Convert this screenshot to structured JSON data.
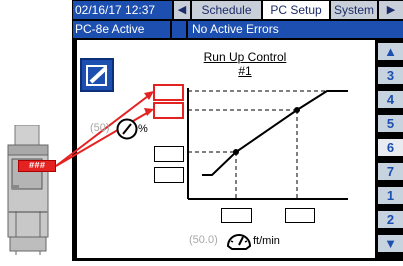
{
  "header": {
    "datetime": "02/16/17 12:37",
    "back_arrow": "◀",
    "tabs": [
      {
        "label": "Schedule",
        "active": false
      },
      {
        "label": "PC Setup",
        "active": true
      },
      {
        "label": "System",
        "active": false
      }
    ],
    "forward_arrow": "▶",
    "status_left": "PC-8e Active",
    "status_right": "No Active Errors"
  },
  "screen": {
    "title": "Run Up Control",
    "subtitle": "#1",
    "edit_icon": "edit-pencil-icon",
    "pressure_value": "(50)",
    "pressure_unit": "%",
    "speed_value": "(50.0)",
    "speed_unit": "ft/min"
  },
  "side_buttons": {
    "up": "▲",
    "items": [
      "3",
      "4",
      "5",
      "6",
      "7",
      "1",
      "2"
    ],
    "down": "▼",
    "selected": "6"
  },
  "device": {
    "display": "###"
  },
  "colors": {
    "header_blue": "#1d4fb0",
    "highlight_red": "#e52222"
  }
}
